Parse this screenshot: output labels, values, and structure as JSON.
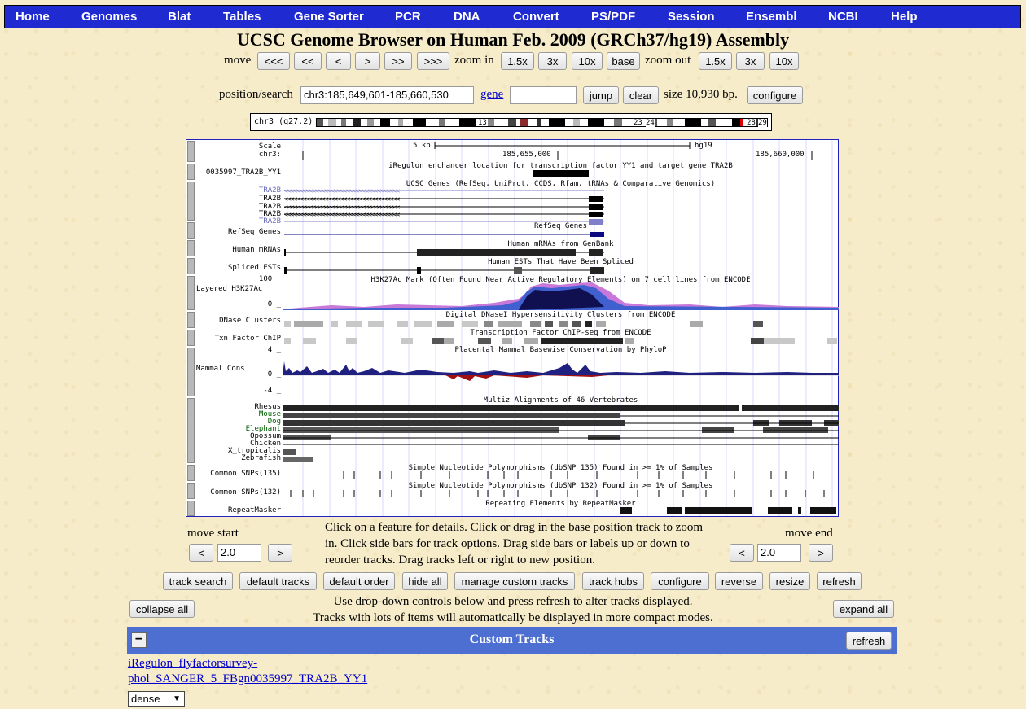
{
  "nav": [
    "Home",
    "Genomes",
    "Blat",
    "Tables",
    "Gene Sorter",
    "PCR",
    "DNA",
    "Convert",
    "PS/PDF",
    "Session",
    "Ensembl",
    "NCBI",
    "Help"
  ],
  "title": "UCSC Genome Browser on Human Feb. 2009 (GRCh37/hg19) Assembly",
  "movebar": {
    "move_label": "move",
    "move_buttons": [
      "<<<",
      "<<",
      "<",
      ">",
      ">>",
      ">>>"
    ],
    "zoomin_label": "zoom in",
    "zoomin_buttons": [
      "1.5x",
      "3x",
      "10x",
      "base"
    ],
    "zoomout_label": "zoom out",
    "zoomout_buttons": [
      "1.5x",
      "3x",
      "10x"
    ]
  },
  "search": {
    "label": "position/search",
    "position": "chr3:185,649,601-185,660,530",
    "gene_link": "gene",
    "gene_value": "",
    "jump": "jump",
    "clear": "clear",
    "size": "size 10,930 bp.",
    "configure": "configure"
  },
  "ideogram": {
    "chrom_label": "chr3 (q27.2)",
    "band_labels": [
      "13",
      "23",
      "24",
      "28",
      "29"
    ]
  },
  "tracks": {
    "scale_label": "Scale",
    "chr_label": "chr3:",
    "scale_text": "5 kb",
    "assembly": "hg19",
    "coord1": "185,655,000",
    "coord2": "185,660,000",
    "iregulon_title": "iRegulon enchancer location for transcription factor YY1 and target gene TRA2B",
    "iregulon_label": "0035997_TRA2B_YY1",
    "ucsc_title": "UCSC Genes (RefSeq, UniProt, CCDS, Rfam, tRNAs & Comparative Genomics)",
    "ucsc_genes": [
      "TRA2B",
      "TRA2B",
      "TRA2B",
      "TRA2B",
      "TRA2B"
    ],
    "refseq_title": "RefSeq Genes",
    "refseq_label": "RefSeq Genes",
    "mrna_title": "Human mRNAs from GenBank",
    "mrna_label": "Human mRNAs",
    "est_title": "Human ESTs That Have Been Spliced",
    "est_label": "Spliced ESTs",
    "h3k_title": "H3K27Ac Mark (Often Found Near Active Regulatory Elements) on 7 cell lines from ENCODE",
    "h3k_label": "Layered H3K27Ac",
    "h3k_max": "100 _",
    "h3k_min": "0 _",
    "dnase_title": "Digital DNaseI Hypersensitivity Clusters from ENCODE",
    "dnase_label": "DNase Clusters",
    "txn_title": "Transcription Factor ChIP-seq from ENCODE",
    "txn_label": "Txn Factor ChIP",
    "cons_title": "Placental Mammal Basewise Conservation by PhyloP",
    "cons_label": "Mammal Cons",
    "cons_max": "4 _",
    "cons_zero": "0 _",
    "cons_min": "-4 _",
    "multiz_title": "Multiz Alignments of 46 Vertebrates",
    "species": [
      "Rhesus",
      "Mouse",
      "Dog",
      "Elephant",
      "Opossum",
      "Chicken",
      "X_tropicalis",
      "Zebrafish"
    ],
    "snp135_title": "Simple Nucleotide Polymorphisms (dbSNP 135) Found in >= 1% of Samples",
    "snp135_label": "Common SNPs(135)",
    "snp132_title": "Simple Nucleotide Polymorphisms (dbSNP 132) Found in >= 1% of Samples",
    "snp132_label": "Common SNPs(132)",
    "repeat_title": "Repeating Elements by RepeatMasker",
    "repeat_label": "RepeatMasker"
  },
  "below": {
    "move_start": "move start",
    "move_end": "move end",
    "start_value": "2.0",
    "end_value": "2.0",
    "left_arrow": "<",
    "right_arrow": ">",
    "instructions": "Click on a feature for details. Click or drag in the base position track to zoom in. Click side bars for track options. Drag side bars or labels up or down to reorder tracks. Drag tracks left or right to new position."
  },
  "toolbar": [
    "track search",
    "default tracks",
    "default order",
    "hide all",
    "manage custom tracks",
    "track hubs",
    "configure",
    "reverse",
    "resize",
    "refresh"
  ],
  "controls": {
    "collapse_all": "collapse all",
    "expand_all": "expand all",
    "line1": "Use drop-down controls below and press refresh to alter tracks displayed.",
    "line2": "Tracks with lots of items will automatically be displayed in more compact modes."
  },
  "custom_tracks": {
    "collapse_symbol": "−",
    "title": "Custom Tracks",
    "refresh": "refresh",
    "track_link_line1": "iRegulon_flyfactorsurvey-",
    "track_link_line2": "phol_SANGER_5_FBgn0035997_TRA2B_YY1",
    "mode": "dense"
  },
  "colors": {
    "nav_bg": "#1f2bd1",
    "custom_bar": "#4c6fd1",
    "gene_blue": "#0a0a80",
    "ucsc_light": "#8080c8",
    "mouse_green": "#006000"
  }
}
